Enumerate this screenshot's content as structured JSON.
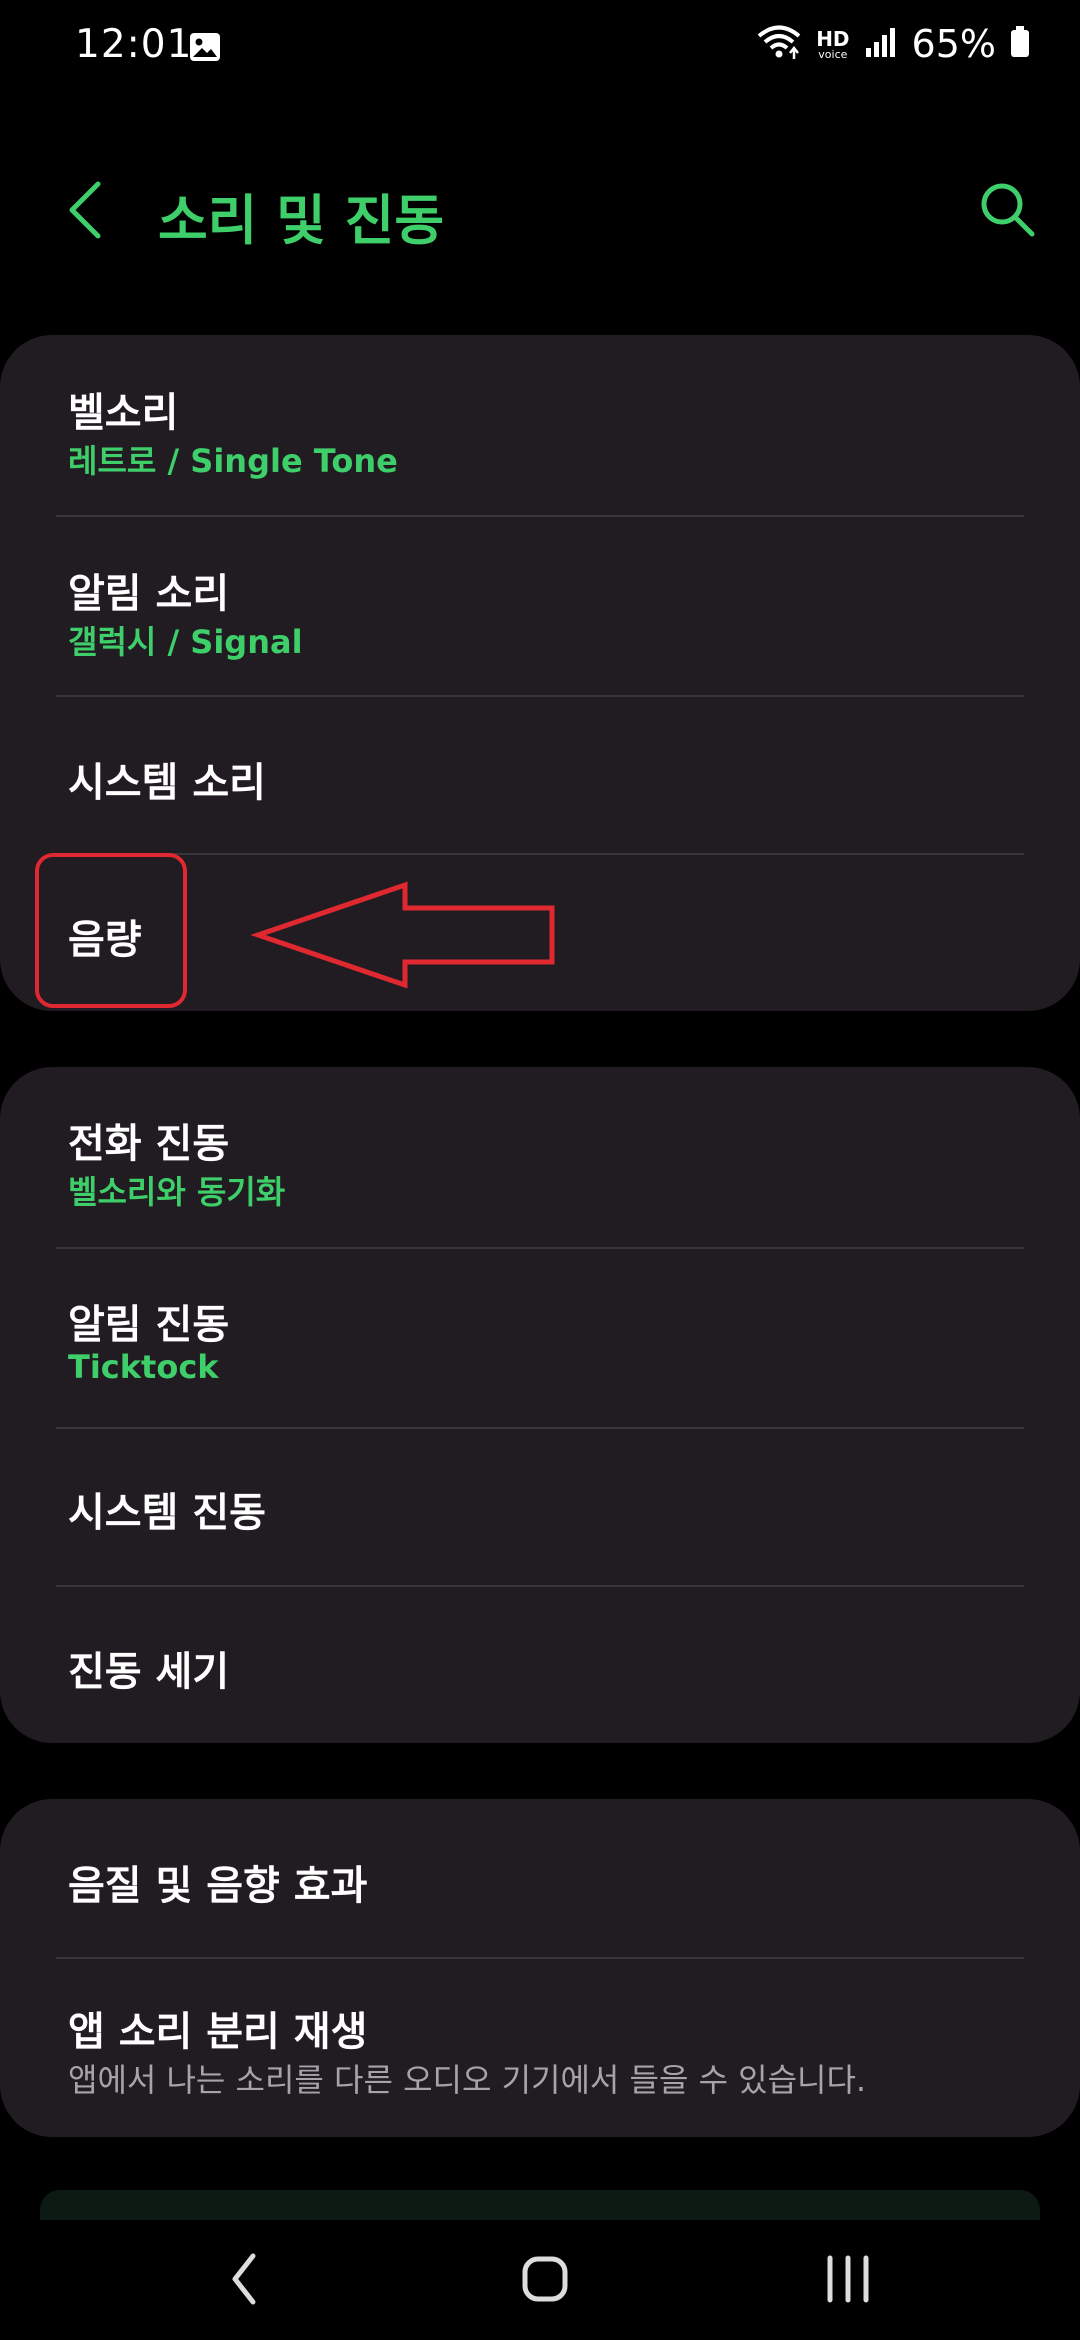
{
  "status_bar": {
    "time": "12:01",
    "hd_label": "HD",
    "voice_label": "voice",
    "battery": "65%"
  },
  "app_bar": {
    "title": "소리 및 진동"
  },
  "cards": [
    {
      "items": [
        {
          "title": "벨소리",
          "subtitle": "레트로 / Single Tone"
        },
        {
          "title": "알림 소리",
          "subtitle": "갤럭시 / Signal"
        },
        {
          "title": "시스템 소리"
        },
        {
          "title": "음량"
        }
      ]
    },
    {
      "items": [
        {
          "title": "전화 진동",
          "subtitle": "벨소리와 동기화"
        },
        {
          "title": "알림 진동",
          "subtitle": "Ticktock"
        },
        {
          "title": "시스템 진동"
        },
        {
          "title": "진동 세기"
        }
      ]
    },
    {
      "items": [
        {
          "title": "음질 및 음향 효과"
        },
        {
          "title": "앱 소리 분리 재생",
          "subtitle": "앱에서 나는 소리를 다른 오디오 기기에서 들을 수 있습니다."
        }
      ]
    }
  ],
  "colors": {
    "accent": "#3ecf6a",
    "card_bg": "#211b22",
    "annotation": "#e02830"
  },
  "icons": [
    "image-icon",
    "wifi-icon",
    "signal-icon",
    "battery-icon",
    "back-icon",
    "search-icon",
    "nav-back-icon",
    "nav-home-icon",
    "nav-recents-icon"
  ]
}
